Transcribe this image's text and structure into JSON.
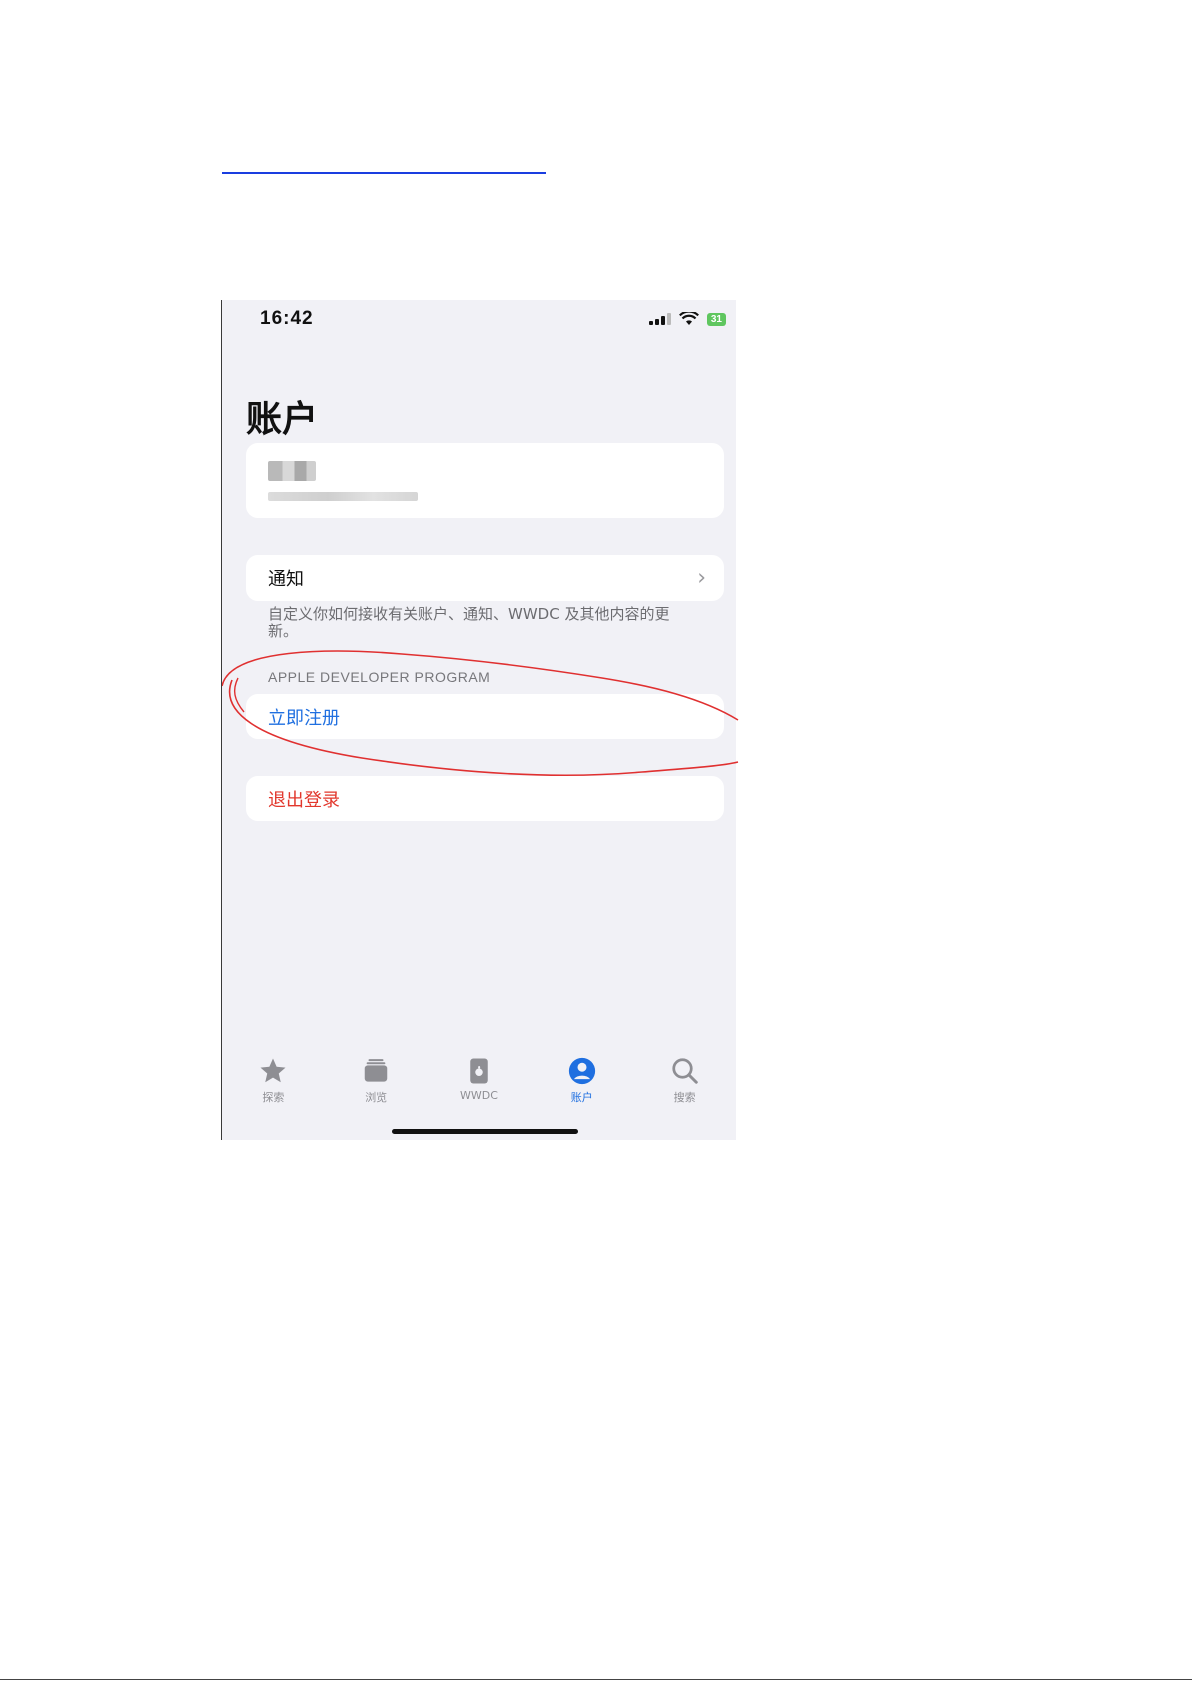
{
  "status_bar": {
    "time": "16:42",
    "battery": "31"
  },
  "title": "账户",
  "notifications": {
    "label": "通知",
    "footer": "自定义你如何接收有关账户、通知、WWDC 及其他内容的更新。"
  },
  "developer_program": {
    "header": "APPLE DEVELOPER PROGRAM",
    "enroll_label": "立即注册"
  },
  "sign_out_label": "退出登录",
  "tabs": [
    {
      "label": "探索",
      "icon": "star-icon"
    },
    {
      "label": "浏览",
      "icon": "stack-icon"
    },
    {
      "label": "WWDC",
      "icon": "wwdc-icon"
    },
    {
      "label": "账户",
      "icon": "person-icon",
      "active": true
    },
    {
      "label": "搜索",
      "icon": "search-icon"
    }
  ],
  "colors": {
    "accent": "#1f6fe0",
    "destructive": "#e2372c",
    "annotation": "#e03030",
    "background": "#f1f1f6"
  }
}
